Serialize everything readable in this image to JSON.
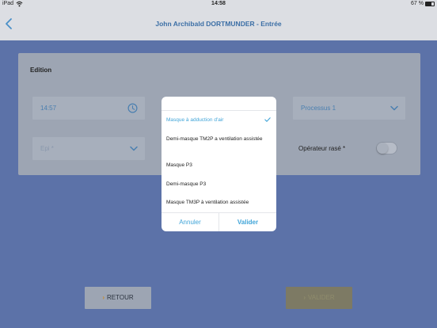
{
  "status_bar": {
    "device": "iPad",
    "time": "14:58",
    "battery": "67 %",
    "battery_level": 0.67
  },
  "nav": {
    "title": "John Archibald DORTMUNDER - Entrée"
  },
  "form": {
    "heading": "Edition",
    "time_value": "14:57",
    "process_value": "Processus 1",
    "epi_placeholder": "Epi *",
    "shaved_label": "Opérateur rasé *"
  },
  "picker": {
    "options": [
      {
        "label": "Masque à adduction d'air",
        "selected": true
      },
      {
        "label": "Demi-masque TM2P a ventilation assistée",
        "selected": false
      },
      {
        "label": "Masque P3",
        "selected": false
      },
      {
        "label": "Demi-masque P3",
        "selected": false
      },
      {
        "label": "Masque TM3P à ventilation assistée",
        "selected": false
      }
    ],
    "cancel_label": "Annuler",
    "confirm_label": "Valider"
  },
  "footer": {
    "back_label": "RETOUR",
    "submit_label": "VALIDER"
  },
  "colors": {
    "accent": "#3fa4d8",
    "navy_backdrop": "#5c72a8",
    "submit_bg": "#7d7a64",
    "arrow": "#c98d2a"
  }
}
